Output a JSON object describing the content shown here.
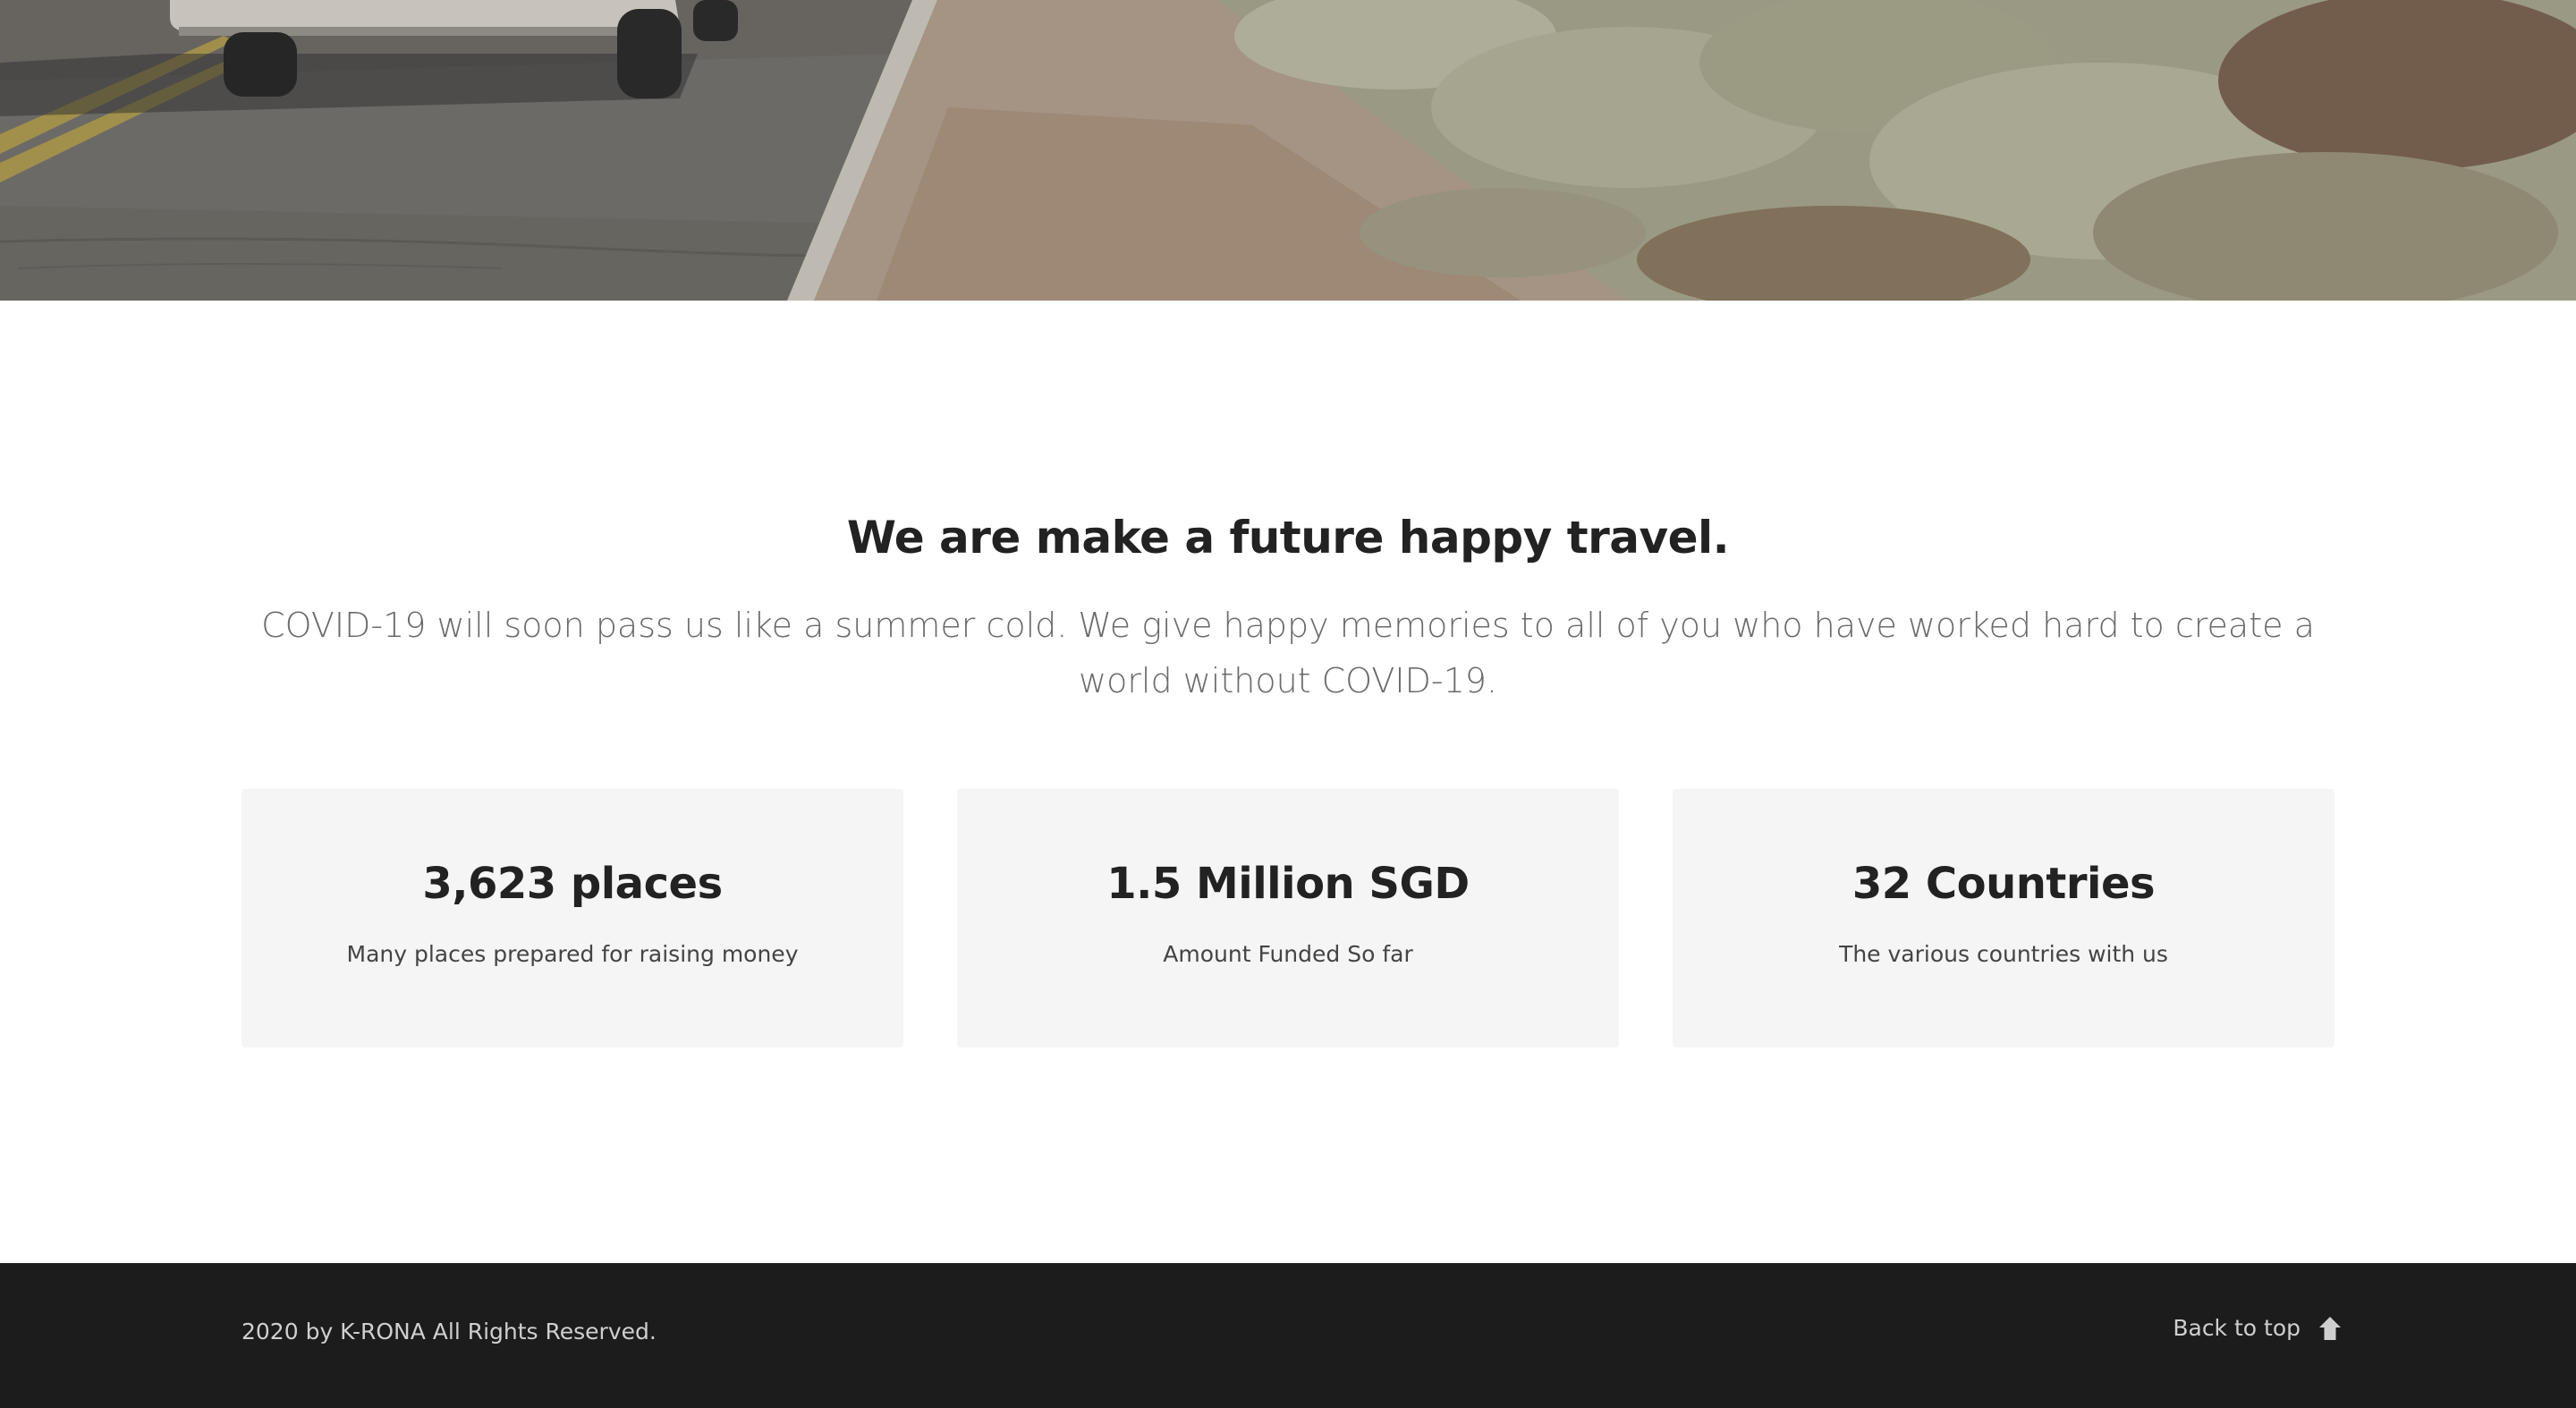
{
  "hero": {
    "image": "road-desert-van-photo"
  },
  "intro": {
    "title": "We are make a future happy travel.",
    "text": "COVID-19 will soon pass us like a summer cold. We give happy memories to all of you who have worked hard to create a world without COVID-19."
  },
  "stats": [
    {
      "title": "3,623 places",
      "subtitle": "Many places prepared for raising money"
    },
    {
      "title": "1.5 Million SGD",
      "subtitle": "Amount Funded So far"
    },
    {
      "title": "32 Countries",
      "subtitle": "The various countries with us"
    }
  ],
  "footer": {
    "copyright": "2020 by K-RONA All Rights Reserved.",
    "back_to_top": "Back to top",
    "back_to_top_icon": "arrow-up-icon"
  },
  "colors": {
    "footer_bg": "#1c1c1c",
    "card_bg": "#f4f5f4",
    "heading": "#222222",
    "body_text": "#6a6a6a"
  }
}
